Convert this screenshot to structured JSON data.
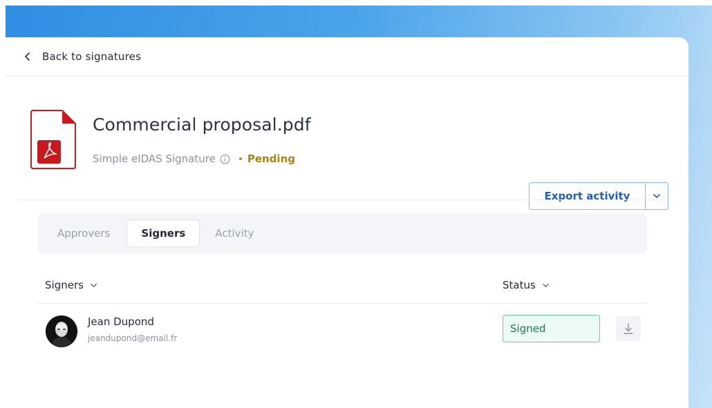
{
  "nav": {
    "back_label": "Back to signatures"
  },
  "document": {
    "title": "Commercial proposal.pdf",
    "signature_type": "Simple eIDAS Signature",
    "status": "Pending"
  },
  "actions": {
    "export_label": "Export activity"
  },
  "tabs": [
    {
      "label": "Approvers",
      "active": false
    },
    {
      "label": "Signers",
      "active": true
    },
    {
      "label": "Activity",
      "active": false
    }
  ],
  "table": {
    "columns": {
      "signers": "Signers",
      "status": "Status"
    },
    "rows": [
      {
        "name": "Jean Dupond",
        "email": "jeandupond@email.fr",
        "status": "Signed"
      }
    ]
  },
  "colors": {
    "accent": "#1f5fb8",
    "pending": "#a9820f",
    "signed_border": "#5fd39a",
    "signed_bg": "#ecfbf3",
    "pdf_red": "#c8191f"
  },
  "icons": {
    "back": "chevron-left-icon",
    "file": "pdf-file-icon",
    "info": "info-icon",
    "dropdown": "chevron-down-icon",
    "download": "download-icon"
  }
}
